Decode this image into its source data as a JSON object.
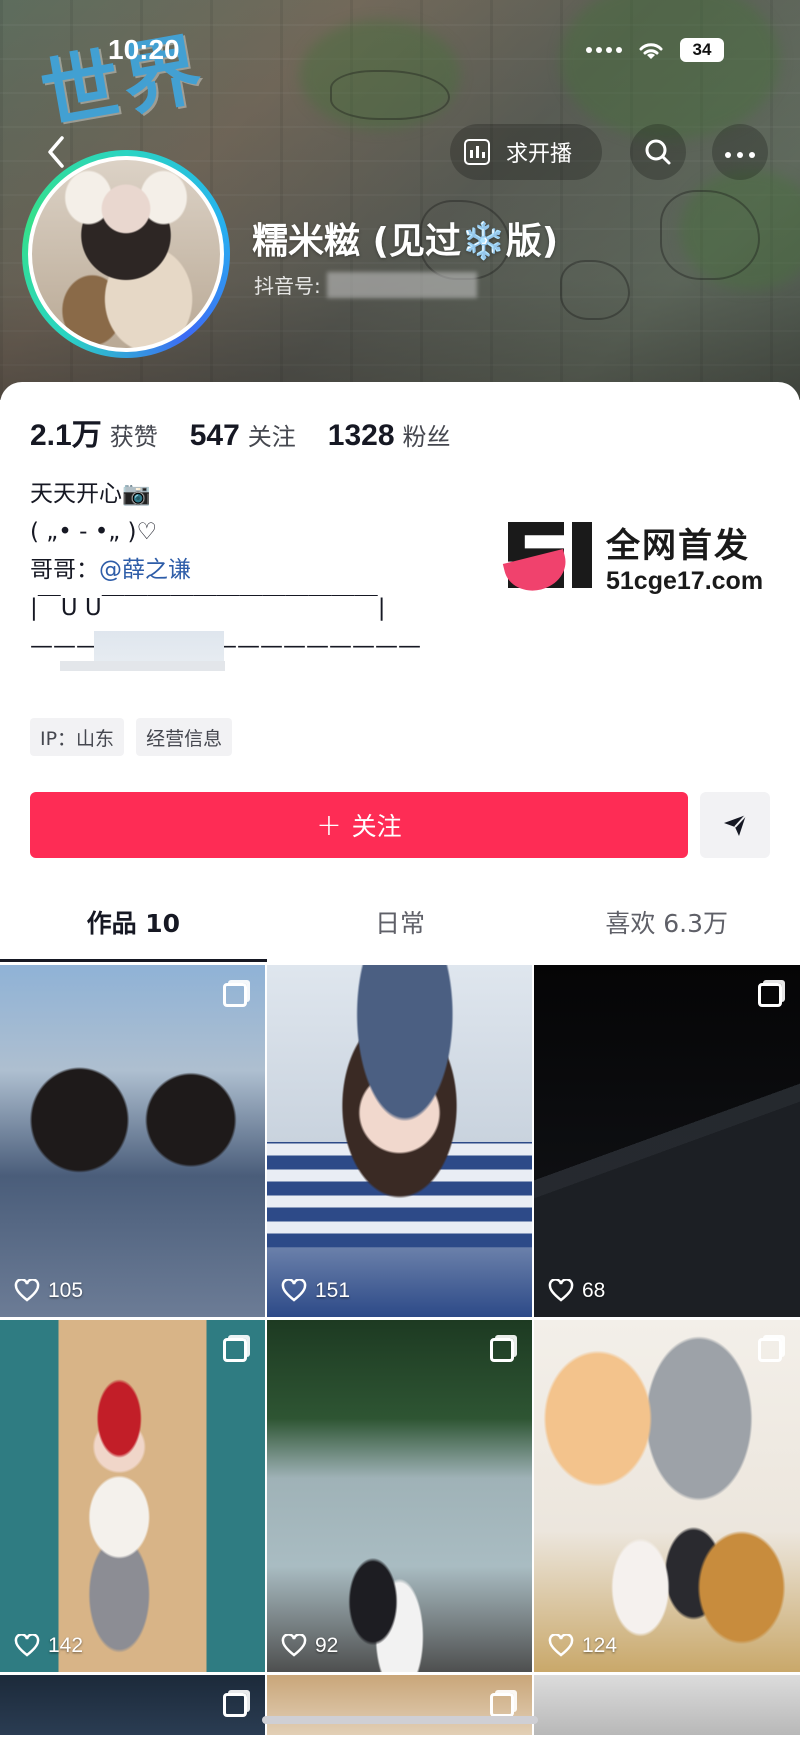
{
  "status_bar": {
    "time": "10:20",
    "battery": "34"
  },
  "header": {
    "live_request_label": "求开播",
    "nickname": "糯米糍 (见过❄️版)",
    "douyin_id_prefix": "抖音号:"
  },
  "profile": {
    "stats": [
      {
        "value": "2.1万",
        "label": "获赞"
      },
      {
        "value": "547",
        "label": "关注"
      },
      {
        "value": "1328",
        "label": "粉丝"
      }
    ],
    "bio": {
      "line1": "天天开心📷",
      "line2": "( „• - •„ )♡",
      "line3_prefix": "哥哥：",
      "line3_mention": "@薛之谦",
      "line4": "|￣U U￣￣￣￣￣￣￣￣￣￣￣￣|",
      "line5": "—————————————————"
    },
    "tags": [
      "IP：山东",
      "经营信息"
    ],
    "follow_button": "关注"
  },
  "watermark": {
    "title": "全网首发",
    "site": "51cge17.com"
  },
  "tabs": [
    "作品 10",
    "日常",
    "喜欢 6.3万"
  ],
  "videos": [
    {
      "likes": "105",
      "multi": true
    },
    {
      "likes": "151",
      "multi": false
    },
    {
      "likes": "68",
      "multi": true
    },
    {
      "likes": "142",
      "multi": true
    },
    {
      "likes": "92",
      "multi": true
    },
    {
      "likes": "124",
      "multi": true
    }
  ],
  "colors": {
    "accent": "#fe2c55",
    "mention": "#2e5da8",
    "text": "#161823"
  }
}
